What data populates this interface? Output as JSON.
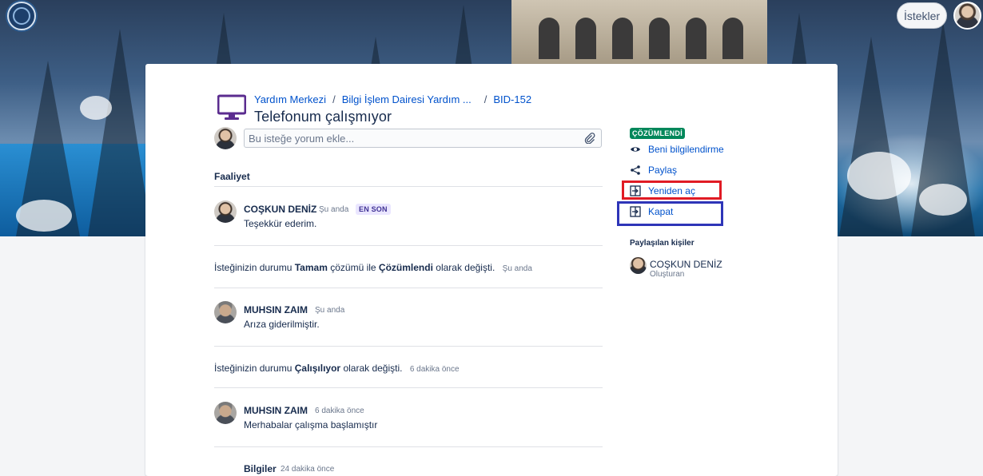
{
  "header": {
    "requests_button": "İstekler"
  },
  "breadcrumb": {
    "items": [
      "Yardım Merkezi",
      "Bilgi İşlem Dairesi Yardım ...",
      "BID-152"
    ],
    "separator": "/"
  },
  "request": {
    "title": "Telefonum çalışmıyor",
    "status": "ÇÖZÜMLENDİ",
    "comment_placeholder": "Bu isteğe yorum ekle..."
  },
  "activity": {
    "title": "Faaliyet",
    "entries": [
      {
        "author": "COŞKUN DENİZ",
        "time": "Şu anda",
        "badge": "EN SON",
        "text": "Teşekkür ederim."
      },
      {
        "status_prefix": "İsteğinizin durumu",
        "resolution": "Tamam",
        "mid": "çözümü ile",
        "status": "Çözümlendi",
        "suffix": "olarak değişti.",
        "time": "Şu anda"
      },
      {
        "author": "MUHSIN ZAIM",
        "time": "Şu anda",
        "text": "Arıza giderilmiştir."
      },
      {
        "status_prefix": "İsteğinizin durumu",
        "status": "Çalışılıyor",
        "suffix": "olarak değişti.",
        "time": "6 dakika önce"
      },
      {
        "author": "MUHSIN ZAIM",
        "time": "6 dakika önce",
        "text": "Merhabalar çalışma başlamıştır"
      },
      {
        "author": "Bilgiler",
        "time": "24 dakika önce"
      }
    ]
  },
  "sidebar": {
    "actions": [
      {
        "label": "Beni bilgilendirme",
        "icon": "eye-icon"
      },
      {
        "label": "Paylaş",
        "icon": "share-icon"
      },
      {
        "label": "Yeniden aç",
        "icon": "transition-icon"
      },
      {
        "label": "Kapat",
        "icon": "transition-icon"
      }
    ],
    "shared_heading": "Paylaşılan kişiler",
    "shared_people": [
      {
        "name": "COŞKUN DENİZ",
        "role": "Oluşturan"
      }
    ]
  },
  "colors": {
    "link": "#0052cc",
    "status_resolved": "#00875a",
    "badge_latest_bg": "#eae6ff",
    "highlight_red": "#e01b24",
    "highlight_blue": "#2e35b8"
  }
}
